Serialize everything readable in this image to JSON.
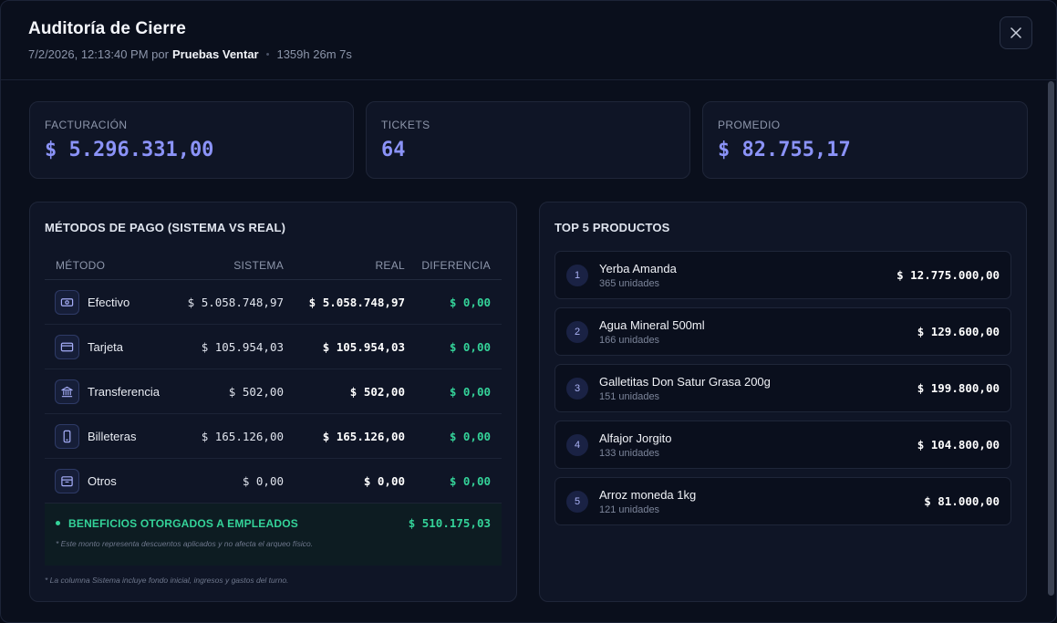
{
  "header": {
    "title": "Auditoría de Cierre",
    "datetime": "7/2/2026, 12:13:40 PM por",
    "user": "Pruebas Ventar",
    "separator": "•",
    "duration": "1359h 26m 7s",
    "close_icon": "close-icon"
  },
  "stats": [
    {
      "label": "FACTURACIÓN",
      "value": "$ 5.296.331,00"
    },
    {
      "label": "TICKETS",
      "value": "64"
    },
    {
      "label": "PROMEDIO",
      "value": "$ 82.755,17"
    }
  ],
  "payments": {
    "title": "MÉTODOS DE PAGO (SISTEMA VS REAL)",
    "headers": {
      "method": "MÉTODO",
      "system": "SISTEMA",
      "real": "REAL",
      "diff": "DIFERENCIA"
    },
    "rows": [
      {
        "icon": "cash-icon",
        "method": "Efectivo",
        "system": "$ 5.058.748,97",
        "real": "$ 5.058.748,97",
        "diff": "$ 0,00"
      },
      {
        "icon": "card-icon",
        "method": "Tarjeta",
        "system": "$ 105.954,03",
        "real": "$ 105.954,03",
        "diff": "$ 0,00"
      },
      {
        "icon": "bank-icon",
        "method": "Transferencia",
        "system": "$ 502,00",
        "real": "$ 502,00",
        "diff": "$ 0,00"
      },
      {
        "icon": "phone-icon",
        "method": "Billeteras",
        "system": "$ 165.126,00",
        "real": "$ 165.126,00",
        "diff": "$ 0,00"
      },
      {
        "icon": "box-icon",
        "method": "Otros",
        "system": "$ 0,00",
        "real": "$ 0,00",
        "diff": "$ 0,00"
      }
    ],
    "benefits": {
      "label": "BENEFICIOS OTORGADOS A EMPLEADOS",
      "value": "$ 510.175,03",
      "note": "* Este monto representa descuentos aplicados y no afecta el arqueo físico."
    },
    "footnote": "* La columna Sistema incluye fondo inicial, ingresos y gastos del turno.",
    "accent_color": "#34d399"
  },
  "top_products": {
    "title": "TOP 5 PRODUCTOS",
    "items": [
      {
        "rank": "1",
        "name": "Yerba Amanda",
        "units": "365 unidades",
        "total": "$ 12.775.000,00"
      },
      {
        "rank": "2",
        "name": "Agua Mineral 500ml",
        "units": "166 unidades",
        "total": "$ 129.600,00"
      },
      {
        "rank": "3",
        "name": "Galletitas Don Satur Grasa 200g",
        "units": "151 unidades",
        "total": "$ 199.800,00"
      },
      {
        "rank": "4",
        "name": "Alfajor Jorgito",
        "units": "133 unidades",
        "total": "$ 104.800,00"
      },
      {
        "rank": "5",
        "name": "Arroz moneda 1kg",
        "units": "121 unidades",
        "total": "$ 81.000,00"
      }
    ]
  }
}
